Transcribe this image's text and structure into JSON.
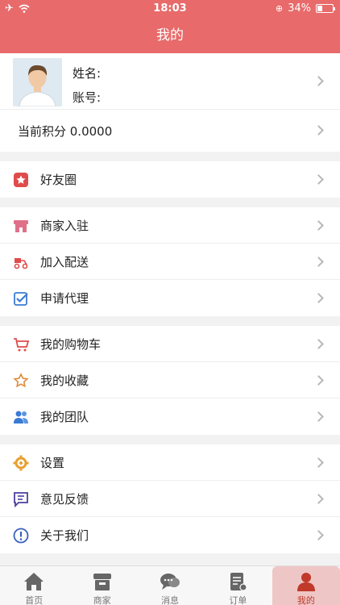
{
  "status": {
    "time": "18:03",
    "battery": "34%",
    "battery_level": 0.34
  },
  "nav": {
    "title": "我的"
  },
  "profile": {
    "name_label": "姓名:",
    "account_label": "账号:"
  },
  "points": {
    "label": "当前积分 0.0000"
  },
  "groups": [
    [
      {
        "label": "好友圈",
        "icon": "star-icon"
      }
    ],
    [
      {
        "label": "商家入驻",
        "icon": "shop-icon"
      },
      {
        "label": "加入配送",
        "icon": "delivery-icon"
      },
      {
        "label": "申请代理",
        "icon": "check-icon"
      }
    ],
    [
      {
        "label": "我的购物车",
        "icon": "cart-icon"
      },
      {
        "label": "我的收藏",
        "icon": "star-outline-icon"
      },
      {
        "label": "我的团队",
        "icon": "team-icon"
      }
    ],
    [
      {
        "label": "设置",
        "icon": "gear-icon"
      },
      {
        "label": "意见反馈",
        "icon": "feedback-icon"
      },
      {
        "label": "关于我们",
        "icon": "info-icon"
      }
    ]
  ],
  "tabs": [
    {
      "label": "首页",
      "icon": "home-icon"
    },
    {
      "label": "商家",
      "icon": "store-icon"
    },
    {
      "label": "消息",
      "icon": "chat-icon"
    },
    {
      "label": "订单",
      "icon": "order-icon"
    },
    {
      "label": "我的",
      "icon": "user-icon"
    }
  ],
  "colors": {
    "brand": "#e86a6a",
    "active_tab_bg": "#efc6c6",
    "active_tab_text": "#c0392b"
  }
}
